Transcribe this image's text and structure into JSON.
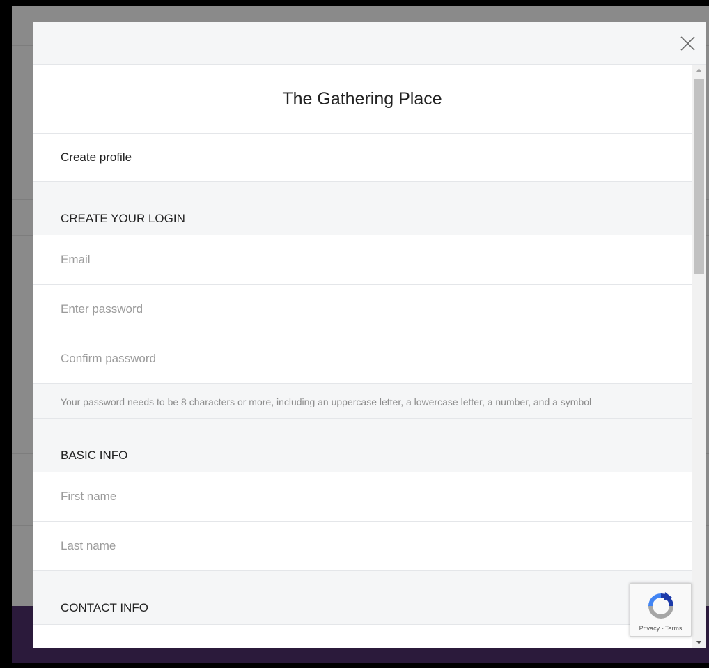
{
  "modal": {
    "title": "The Gathering Place",
    "subtitle": "Create profile",
    "close_icon": "close-icon"
  },
  "login_section": {
    "header": "CREATE YOUR LOGIN",
    "email_placeholder": "Email",
    "password_placeholder": "Enter password",
    "confirm_placeholder": "Confirm password",
    "hint": "Your password needs to be 8 characters or more, including an uppercase letter, a lowercase letter, a number, and a symbol"
  },
  "basic_section": {
    "header": "BASIC INFO",
    "first_name_placeholder": "First name",
    "last_name_placeholder": "Last name"
  },
  "contact_section": {
    "header": "CONTACT INFO"
  },
  "recaptcha": {
    "privacy": "Privacy",
    "separator": " - ",
    "terms": "Terms",
    "icon": "recaptcha-icon"
  },
  "colors": {
    "panel_gray": "#f5f6f7",
    "divider": "#e4e6e9",
    "placeholder": "#9b9b9b",
    "footer_purple": "#2b1a3b",
    "backdrop": "#8a8a8a"
  }
}
